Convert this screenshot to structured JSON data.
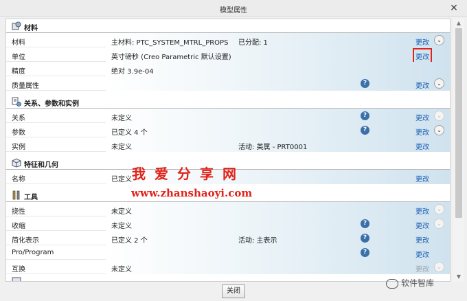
{
  "window": {
    "title": "模型属性",
    "close_glyph": "✕"
  },
  "sections": [
    {
      "key": "materials",
      "label": "材料",
      "icon": "materials-icon"
    },
    {
      "key": "relations",
      "label": "关系、参数和实例",
      "icon": "relations-icon"
    },
    {
      "key": "features",
      "label": "特征和几何",
      "icon": "features-icon"
    },
    {
      "key": "tools",
      "label": "工具",
      "icon": "tools-icon"
    }
  ],
  "rows": {
    "material": {
      "label": "材料",
      "value": "主材料: PTC_SYSTEM_MTRL_PROPS",
      "value2": "已分配: 1",
      "change": "更改",
      "expand": "⌄"
    },
    "units": {
      "label": "单位",
      "value": "英寸磅秒 (Creo Parametric 默认设置)",
      "change": "更改"
    },
    "accuracy": {
      "label": "精度",
      "value": "绝对 3.9e-04"
    },
    "mass_props": {
      "label": "质量属性",
      "help": "?",
      "change": "更改",
      "expand": "⌄"
    },
    "relations": {
      "label": "关系",
      "value": "未定义",
      "help": "?",
      "change": "更改",
      "expand": "⌄"
    },
    "parameters": {
      "label": "参数",
      "value": "已定义 4 个",
      "help": "?",
      "change": "更改",
      "expand": "⌄"
    },
    "instances": {
      "label": "实例",
      "value": "未定义",
      "value2": "活动: 类属 - PRT0001",
      "change": "更改"
    },
    "names": {
      "label": "名称",
      "value": "已定义",
      "change": "更改"
    },
    "flexibility": {
      "label": "挠性",
      "value": "未定义",
      "change": "更改",
      "expand": "⌄"
    },
    "shrinkage": {
      "label": "收缩",
      "value": "未定义",
      "help": "?",
      "change": "更改",
      "expand": "⌄"
    },
    "simplified_rep": {
      "label": "简化表示",
      "value": "已定义 2 个",
      "value2": "活动: 主表示",
      "help": "?",
      "change": "更改"
    },
    "pro_program": {
      "label": "Pro/Program",
      "help": "?",
      "change": "更改"
    },
    "interchange": {
      "label": "互换",
      "value": "未定义",
      "change": "更改",
      "expand": "⌄"
    }
  },
  "footer": {
    "close_label": "关闭"
  },
  "watermark": {
    "title": "我爱分享网",
    "url": "www.zhanshaoyi.com",
    "brand": "软件智库"
  },
  "colors": {
    "link": "#1a5fb4",
    "highlight": "#e0231a",
    "band": "#cfe2ee",
    "help": "#3b6fa8"
  }
}
